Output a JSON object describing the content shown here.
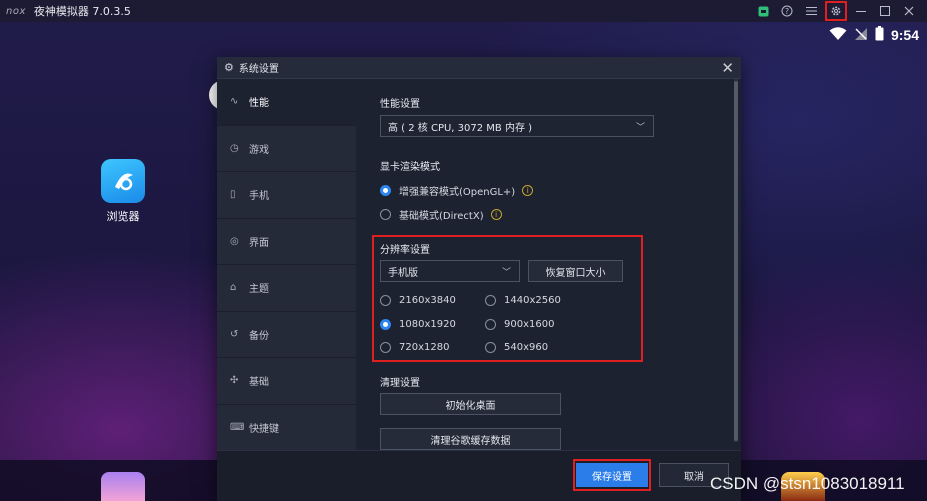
{
  "app": {
    "logo": "nox",
    "title": "夜神模拟器 7.0.3.5"
  },
  "titlebar": {
    "icons": [
      "android-icon",
      "help-icon",
      "menu-icon",
      "gear-icon",
      "minimize-icon",
      "maximize-icon",
      "close-icon"
    ]
  },
  "statusbar": {
    "time": "9:54"
  },
  "desktop": {
    "app_label": "浏览器"
  },
  "dialog": {
    "title": "系统设置",
    "sidebar": [
      {
        "label": "性能",
        "icon": "pulse-icon"
      },
      {
        "label": "游戏",
        "icon": "gamepad-icon"
      },
      {
        "label": "手机",
        "icon": "phone-icon"
      },
      {
        "label": "界面",
        "icon": "eye-icon"
      },
      {
        "label": "主题",
        "icon": "shirt-icon"
      },
      {
        "label": "备份",
        "icon": "history-icon"
      },
      {
        "label": "基础",
        "icon": "puzzle-icon"
      },
      {
        "label": "快捷键",
        "icon": "keyboard-icon"
      }
    ],
    "performance": {
      "title": "性能设置",
      "selected": "高 ( 2 核 CPU, 3072 MB 内存 )"
    },
    "render": {
      "title": "显卡渲染模式",
      "options": [
        {
          "label": "增强兼容模式(OpenGL+)",
          "checked": true
        },
        {
          "label": "基础模式(DirectX)",
          "checked": false
        }
      ]
    },
    "resolution": {
      "title": "分辨率设置",
      "selected": "手机版",
      "restore_button": "恢复窗口大小",
      "options": [
        {
          "label": "2160x3840",
          "checked": false
        },
        {
          "label": "1440x2560",
          "checked": false
        },
        {
          "label": "1080x1920",
          "checked": true
        },
        {
          "label": "900x1600",
          "checked": false
        },
        {
          "label": "720x1280",
          "checked": false
        },
        {
          "label": "540x960",
          "checked": false
        }
      ]
    },
    "cleanup": {
      "title": "清理设置",
      "init_desktop": "初始化桌面",
      "clear_cache": "清理谷歌缓存数据"
    },
    "footer": {
      "save": "保存设置",
      "cancel": "取消"
    }
  },
  "watermark": "CSDN @stsn1083018911",
  "colors": {
    "accent": "#2b7de9",
    "highlight": "#e02020"
  }
}
